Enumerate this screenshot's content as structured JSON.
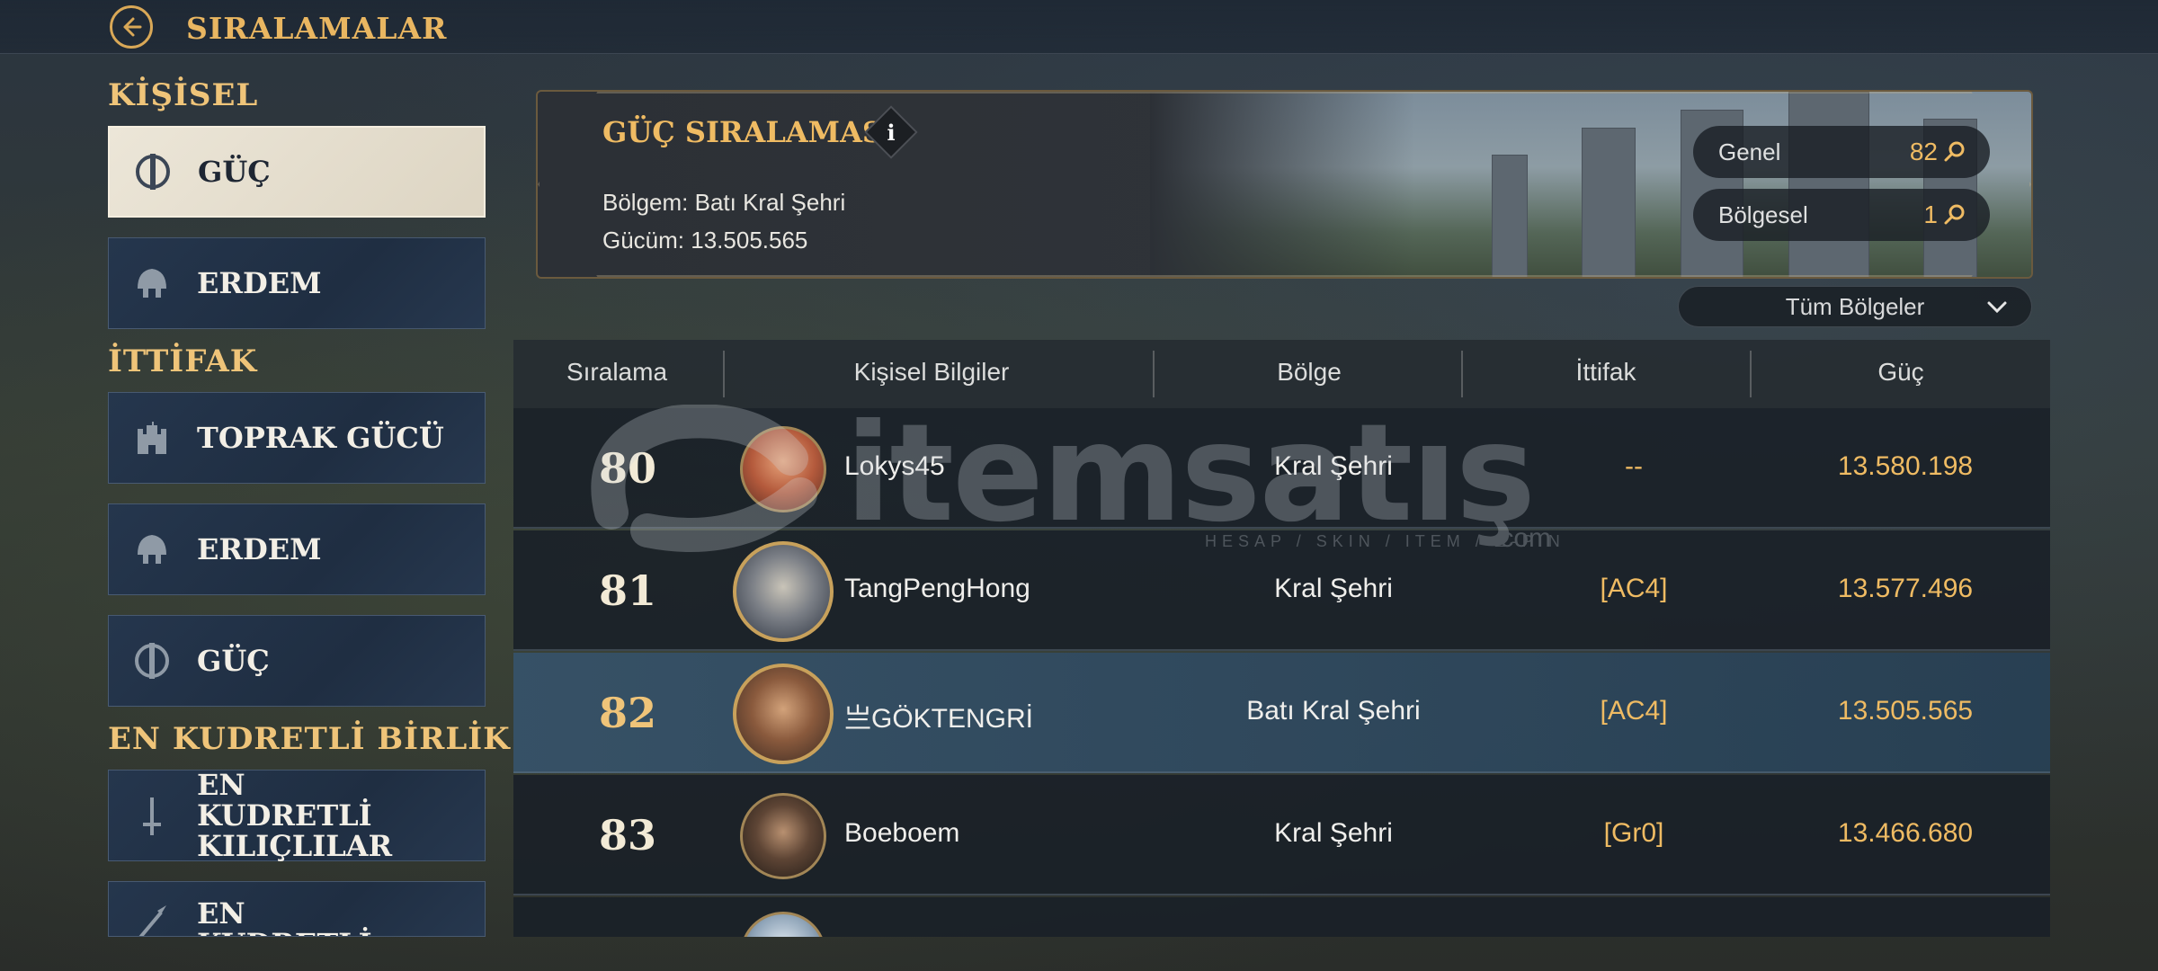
{
  "header": {
    "title": "SIRALAMALAR"
  },
  "sidebar": {
    "sections": [
      {
        "title": "KİŞİSEL"
      },
      {
        "title": "İTTİFAK"
      },
      {
        "title": "EN KUDRETLİ BİRLİK"
      }
    ],
    "items": [
      {
        "label": "GÜÇ",
        "icon": "power-icon",
        "active": true
      },
      {
        "label": "ERDEM",
        "icon": "helmet-icon"
      },
      {
        "label": "TOPRAK GÜCÜ",
        "icon": "castle-icon"
      },
      {
        "label": "ERDEM",
        "icon": "helmet-icon"
      },
      {
        "label": "GÜÇ",
        "icon": "power-icon"
      },
      {
        "label": "EN KUDRETLİ KILIÇLILAR",
        "icon": "sword-icon"
      },
      {
        "label": "EN KUDRETLİ MIZRAKLILAR",
        "icon": "spear-icon"
      }
    ]
  },
  "card": {
    "title": "GÜÇ SIRALAMASI",
    "info_label": "i",
    "region_line": "Bölgem: Batı Kral Şehri",
    "power_line": "Gücüm: 13.505.565",
    "general": {
      "label": "Genel",
      "value": "82"
    },
    "regional": {
      "label": "Bölgesel",
      "value": "1"
    }
  },
  "filter": {
    "selected": "Tüm Bölgeler"
  },
  "table": {
    "columns": [
      "Sıralama",
      "Kişisel Bilgiler",
      "Bölge",
      "İttifak",
      "Güç"
    ],
    "rows": [
      {
        "rank": "80",
        "name": "Lokys45",
        "region": "Kral Şehri",
        "alliance": "--",
        "power": "13.580.198"
      },
      {
        "rank": "81",
        "name": "TangPengHong",
        "region": "Kral Şehri",
        "alliance": "[AC4]",
        "power": "13.577.496"
      },
      {
        "rank": "82",
        "name": "亗GÖKTENGRİ",
        "region": "Batı Kral Şehri",
        "alliance": "[AC4]",
        "power": "13.505.565"
      },
      {
        "rank": "83",
        "name": "Boeboem",
        "region": "Kral Şehri",
        "alliance": "[Gr0]",
        "power": "13.466.680"
      }
    ]
  },
  "watermark": {
    "text": "itemsatış",
    "sub": "HESAP / SKIN / ITEM / E-PIN",
    "com": ".com"
  },
  "colors": {
    "accent": "#efbb63",
    "highlight_row": "#365268",
    "active_tab": "#ece6d8"
  }
}
